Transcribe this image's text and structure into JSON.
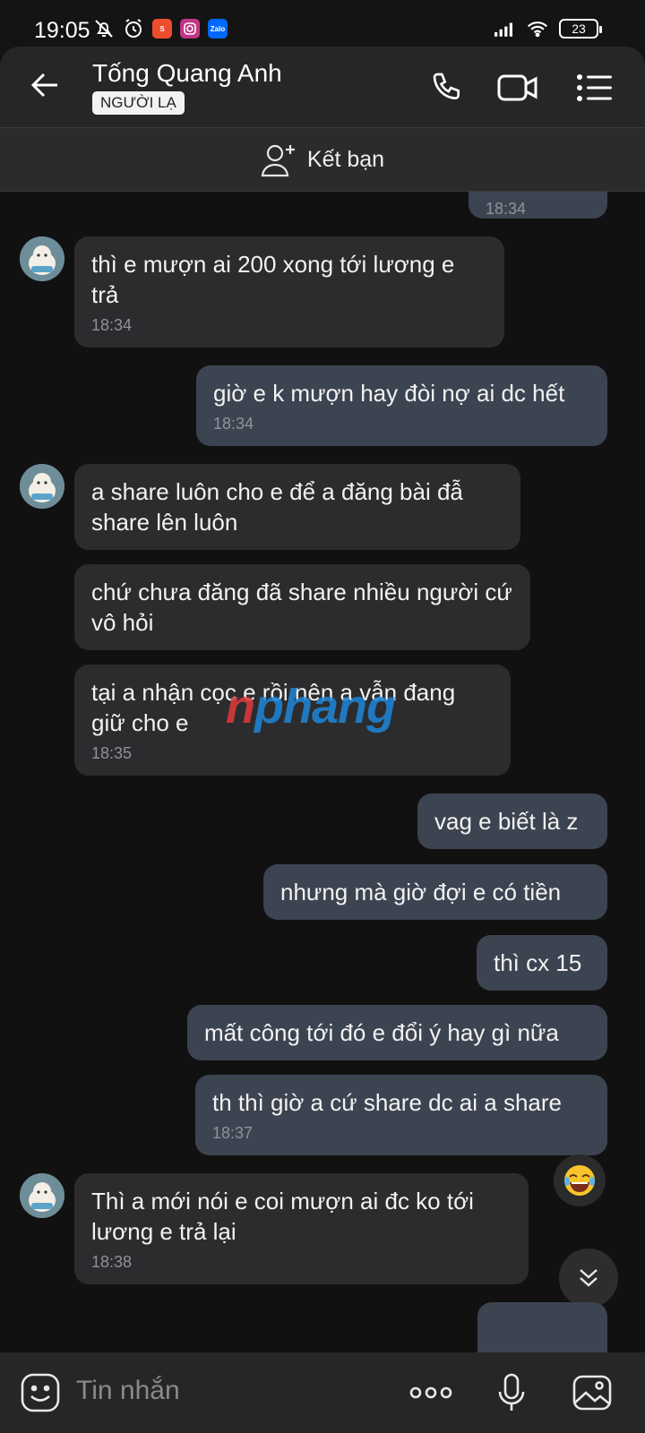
{
  "status_bar": {
    "time": "19:05",
    "battery": "23",
    "apps": [
      {
        "name": "shopee",
        "color": "#ee4d2d"
      },
      {
        "name": "instagram",
        "color": "#c13584"
      },
      {
        "name": "zalo",
        "color": "#0068ff",
        "text": "Zalo"
      }
    ]
  },
  "header": {
    "name": "Tống Quang Anh",
    "badge": "NGƯỜI LẠ"
  },
  "friend_bar": {
    "label": "Kết bạn"
  },
  "messages": [
    {
      "dir": "out",
      "time": "18:34",
      "text": ""
    },
    {
      "dir": "in",
      "text": "thì e mượn ai 200 xong tới lương e trả",
      "time": "18:34"
    },
    {
      "dir": "out",
      "text": "giờ e k mượn hay đòi nợ ai dc hết",
      "time": "18:34"
    },
    {
      "dir": "in",
      "text": "a share luôn cho e để a đăng bài đẫ share lên luôn"
    },
    {
      "dir": "in",
      "text": "chứ chưa đăng đã share nhiều người cứ vô hỏi"
    },
    {
      "dir": "in",
      "text": "tại a nhận cọc e rồi nên a vẫn đang giữ cho e",
      "time": "18:35"
    },
    {
      "dir": "out",
      "text": "vag e biết là z"
    },
    {
      "dir": "out",
      "text": "nhưng mà giờ đợi e có tiền"
    },
    {
      "dir": "out",
      "text": "thì cx 15"
    },
    {
      "dir": "out",
      "text": "mất công tới đó e đổi ý hay gì nữa"
    },
    {
      "dir": "out",
      "text": "th thì giờ a cứ share dc ai a share",
      "time": "18:37"
    },
    {
      "dir": "in",
      "text": "Thì a mới nói e coi mượn ai đc ko tới lương e trả lại",
      "time": "18:38"
    }
  ],
  "watermark": {
    "first": "n",
    "rest": "phang"
  },
  "input_bar": {
    "placeholder": "Tin nhắn"
  },
  "colors": {
    "background": "#111111",
    "incoming_bubble": "#2c2c2e",
    "outgoing_bubble": "#3d4451",
    "header": "#262626"
  }
}
